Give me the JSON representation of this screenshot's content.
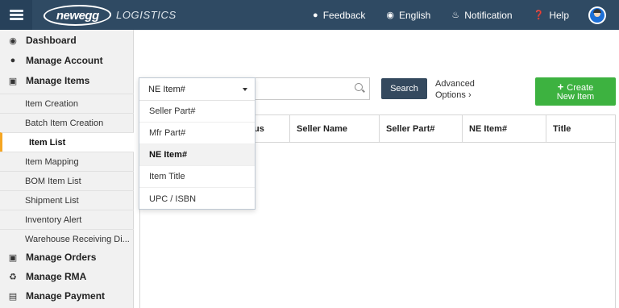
{
  "header": {
    "logo_word": "newegg",
    "logo_sub": "LOGISTICS",
    "nav": [
      {
        "label": "Feedback",
        "icon": "chat-bubble-icon"
      },
      {
        "label": "English",
        "icon": "globe-icon"
      },
      {
        "label": "Notification",
        "icon": "bell-icon"
      },
      {
        "label": "Help",
        "icon": "question-icon"
      }
    ]
  },
  "sidebar": {
    "dashboard": "Dashboard",
    "manage_account": "Manage Account",
    "manage_items": "Manage Items",
    "items": [
      "Item Creation",
      "Batch Item Creation",
      "Item List",
      "Item Mapping",
      "BOM Item List",
      "Shipment List",
      "Inventory Alert",
      "Warehouse Receiving Di..."
    ],
    "manage_orders": "Manage Orders",
    "manage_rma": "Manage RMA",
    "manage_payment": "Manage Payment"
  },
  "search": {
    "button": "Search",
    "advanced_line1": "Advanced",
    "advanced_line2": "Options ›",
    "create_line1": "Create",
    "create_line2": "New Item"
  },
  "dropdown": {
    "selected": "NE Item#",
    "options": [
      "Seller Part#",
      "Mfr Part#",
      "NE Item#",
      "Item Title",
      "UPC / ISBN"
    ]
  },
  "table": {
    "columns": [
      "us",
      "Seller Name",
      "Seller Part#",
      "NE Item#",
      "Title"
    ]
  },
  "colors": {
    "topbar": "#2f4a63",
    "accent": "#f5a623",
    "search_button": "#34495e",
    "create_button": "#3db240"
  }
}
